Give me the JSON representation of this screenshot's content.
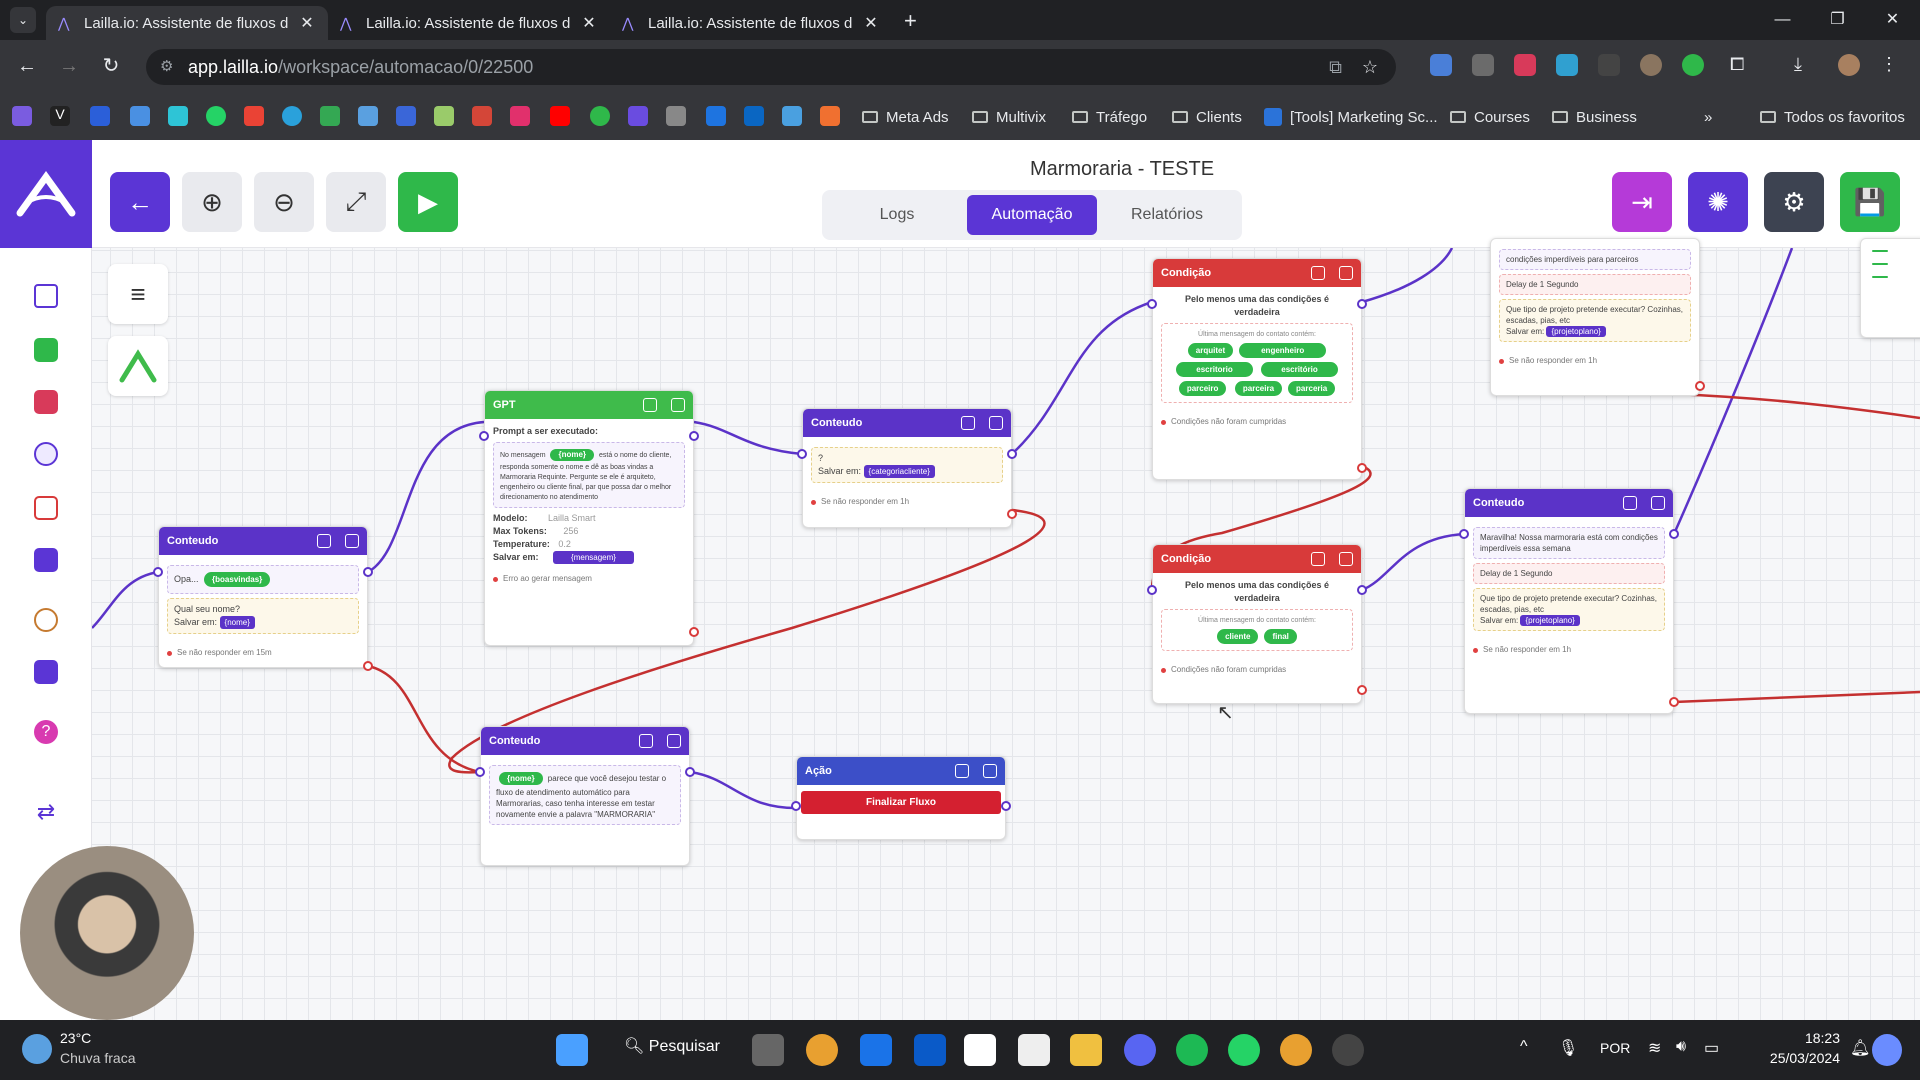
{
  "browser": {
    "tabs": [
      {
        "title": "Lailla.io: Assistente de fluxos d",
        "active": true
      },
      {
        "title": "Lailla.io: Assistente de fluxos d",
        "active": false
      },
      {
        "title": "Lailla.io: Assistente de fluxos d",
        "active": false
      }
    ],
    "new_tab": "+",
    "url_host": "app.lailla.io",
    "url_path": "/workspace/automacao/0/22500",
    "bookmarks": [
      "Meta Ads",
      "Multivix",
      "Tráfego",
      "Clients",
      "[Tools] Marketing Sc...",
      "Courses",
      "Business"
    ],
    "bookmarks_more": "»",
    "all_bookmarks": "Todos os favoritos"
  },
  "app": {
    "title": "Marmoraria - TESTE",
    "tabs": [
      "Logs",
      "Automação",
      "Relatórios"
    ],
    "active_tab": "Automação"
  },
  "nodes": {
    "conteudo1": {
      "header": "Conteudo",
      "line1": "Opa...",
      "chip1": "{boasvindas}",
      "line2": "Qual seu nome?",
      "save": "Salvar em:",
      "var": "{nome}",
      "footer": "Se não responder em 15m"
    },
    "gpt": {
      "header": "GPT",
      "prompt_label": "Prompt a ser executado:",
      "prompt_pre": "No mensagem",
      "prompt_chip": "{nome}",
      "prompt_text": "está o nome do cliente, responda somente o nome e dê as boas vindas a Marmoraria Requinte. Pergunte se ele é arquiteto, engenheiro ou cliente final, par que possa dar o melhor direcionamento no atendimento",
      "model_label": "Modelo:",
      "model_value": "Lailla Smart",
      "tokens_label": "Max Tokens:",
      "tokens_value": "256",
      "temp_label": "Temperature:",
      "temp_value": "0.2",
      "save_label": "Salvar em:",
      "save_var": "{mensagem}",
      "footer": "Erro ao gerar mensagem"
    },
    "conteudo2": {
      "header": "Conteudo",
      "line1": "?",
      "save": "Salvar em:",
      "var": "{categoriacliente}",
      "footer": "Se não responder em 1h"
    },
    "conteudo3": {
      "header": "Conteudo",
      "chip": "{nome}",
      "text": "parece que você desejou testar o fluxo de atendimento automático para Marmorarias, caso tenha interesse em testar novamente envie a palavra \"MARMORARIA\""
    },
    "acao": {
      "header": "Ação",
      "button": "Finalizar Fluxo"
    },
    "condicao1": {
      "header": "Condição",
      "desc": "Pelo menos uma das condições é verdadeira",
      "rule": "Última mensagem do contato contém:",
      "chips": [
        "arquitet",
        "engenheiro",
        "escritorio",
        "escritório",
        "parceiro",
        "parceira",
        "parceria"
      ],
      "footer": "Condições não foram cumpridas"
    },
    "condicao2": {
      "header": "Condição",
      "desc": "Pelo menos uma das condições é verdadeira",
      "rule": "Última mensagem do contato contém:",
      "chips": [
        "cliente",
        "final"
      ],
      "footer": "Condições não foram cumpridas"
    },
    "conteudo4": {
      "header": "Conteudo",
      "text1": "Maravilha! Nossa marmoraria está com condições imperdíveis essa semana",
      "delay": "Delay de 1 Segundo",
      "text2": "Que tipo de projeto pretende executar? Cozinhas, escadas, pias, etc",
      "save": "Salvar em:",
      "var": "{projetoplano}",
      "footer": "Se não responder em 1h"
    },
    "conteudo_top": {
      "text1": "condições imperdíveis para parceiros",
      "delay": "Delay de 1 Segundo",
      "text2": "Que tipo de projeto pretende executar? Cozinhas, escadas, pias, etc",
      "save": "Salvar em:",
      "var": "{projetoplano}",
      "footer": "Se não responder em 1h"
    }
  },
  "taskbar": {
    "weather_temp": "23°C",
    "weather_desc": "Chuva fraca",
    "search": "Pesquisar",
    "lang": "POR",
    "time": "18:23",
    "date": "25/03/2024"
  },
  "colors": {
    "brand": "#5b35d5",
    "gpt": "#3fbb4b",
    "condition": "#d83a3a",
    "action": "#3c4fc8",
    "save": "#2fb84a"
  }
}
